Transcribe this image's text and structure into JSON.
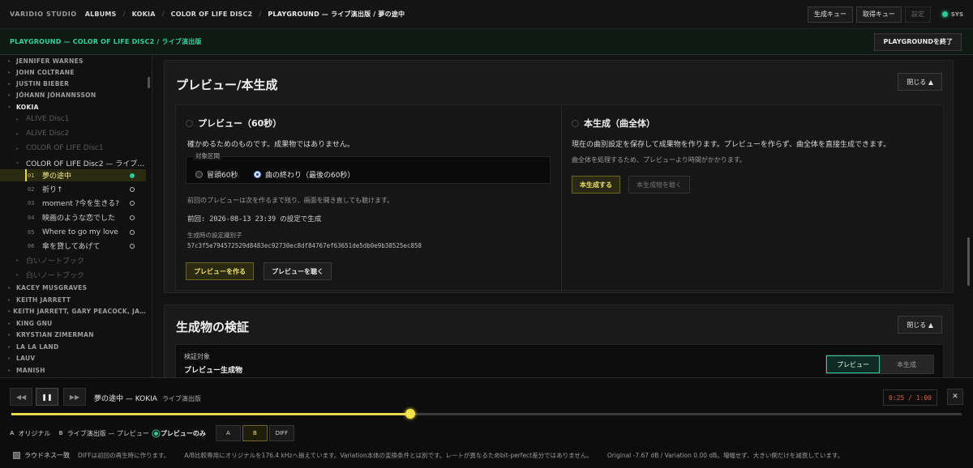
{
  "topbar": {
    "brand": "VARIDIO STUDIO",
    "crumbs": [
      "ALBUMS",
      "KOKIA",
      "COLOR OF LIFE DISC2",
      "PLAYGROUND — ライブ演出版 / 夢の途中"
    ],
    "separator": "/",
    "generate_queue": "生成キュー",
    "fetch_queue": "取得キュー",
    "settings": "設定",
    "sys": "SYS"
  },
  "subbar": {
    "title": "PLAYGROUND — COLOR OF LIFE DISC2 / ライブ演出版",
    "exit": "PLAYGROUNDを終了"
  },
  "sidebar": {
    "artists_top": [
      "JENNIFER WARNES",
      "JOHN COLTRANE",
      "JUSTIN BIEBER",
      "JÓHANN JÓHANNSSON"
    ],
    "open_artist": "KOKIA",
    "albums_before": [
      "ALIVE Disc1",
      "ALIVE Disc2",
      "COLOR OF LIFE Disc1"
    ],
    "open_album": "COLOR OF LIFE Disc2 — ライブ…",
    "tracks": [
      {
        "num": "01",
        "title": "夢の途中"
      },
      {
        "num": "02",
        "title": "祈り↑"
      },
      {
        "num": "03",
        "title": "moment ?今を生きる?"
      },
      {
        "num": "04",
        "title": "映画のような恋でした"
      },
      {
        "num": "05",
        "title": "Where to go my love"
      },
      {
        "num": "06",
        "title": "傘を貸してあげて"
      }
    ],
    "albums_after": [
      "白いノートブック",
      "白いノートブック"
    ],
    "artists_bottom": [
      "KACEY MUSGRAVES",
      "KEITH JARRETT",
      "KEITH JARRETT, GARY PEACOCK, JA…",
      "KING GNU",
      "KRYSTIAN ZIMERMAN",
      "LA LA LAND",
      "LAUV",
      "MANISH"
    ]
  },
  "preview_card": {
    "title": "プレビュー/本生成",
    "close": "閉じる ▲",
    "preview": {
      "title": "プレビュー（60秒）",
      "desc": "確かめるためのものです。成果物ではありません。",
      "range_label": "対象区間",
      "opt_head": "冒頭60秒",
      "opt_end": "曲の終わり（最後の60秒）",
      "note": "前回のプレビューは次を作るまで残り、画面を開き直しても聴けます。",
      "last": "前回: 2026-08-13 23:39 の設定で生成",
      "id_label": "生成時の設定識別子",
      "hash": "57c3f5e794572529d8483ec92730ec8df84767ef63651de5db0e9b38525ec858",
      "make_btn": "プレビューを作る",
      "listen_btn": "プレビューを聴く"
    },
    "full": {
      "title": "本生成（曲全体）",
      "desc": "現在の曲別設定を保存して成果物を作ります。プレビューを作らず、曲全体を直接生成できます。",
      "note": "曲全体を処理するため、プレビューより時間がかかります。",
      "make_btn": "本生成する",
      "listen_btn": "本生成物を聴く"
    }
  },
  "verify_card": {
    "title": "生成物の検証",
    "close": "閉じる ▲",
    "target_label": "検証対象",
    "target_value": "プレビュー生成物",
    "seg_preview": "プレビュー",
    "seg_full": "本生成"
  },
  "player": {
    "prev": "◀◀",
    "pause": "❚❚",
    "next": "▶▶",
    "title": "夢の途中 — KOKIA",
    "subtitle": "ライブ演出版",
    "time": "0:25 / 1:00",
    "progress": 0.42,
    "close": "✕",
    "a_label": "A",
    "a_text": "オリジナル",
    "b_label": "B",
    "b_text": "ライブ演出版 — プレビュー",
    "preview_only": "プレビューのみ",
    "btn_a": "A",
    "btn_b": "B",
    "btn_diff": "DIFF",
    "loudness": "ラウドネス一致",
    "note1": "DIFFは初回の再生時に作ります。",
    "note2": "A/B比較専用にオリジナルを176.4 kHzへ揃えています。Variation本体の変換条件とは別です。レートが異なるためbit-perfect差分ではありません。",
    "note3": "Original -7.67 dB / Variation 0.00 dB。増幅せず、大きい側だけを減衰しています。"
  },
  "colors": {
    "accent_green": "#2ec79a",
    "accent_yellow": "#e8d84a",
    "time_orange": "#e0603a"
  }
}
